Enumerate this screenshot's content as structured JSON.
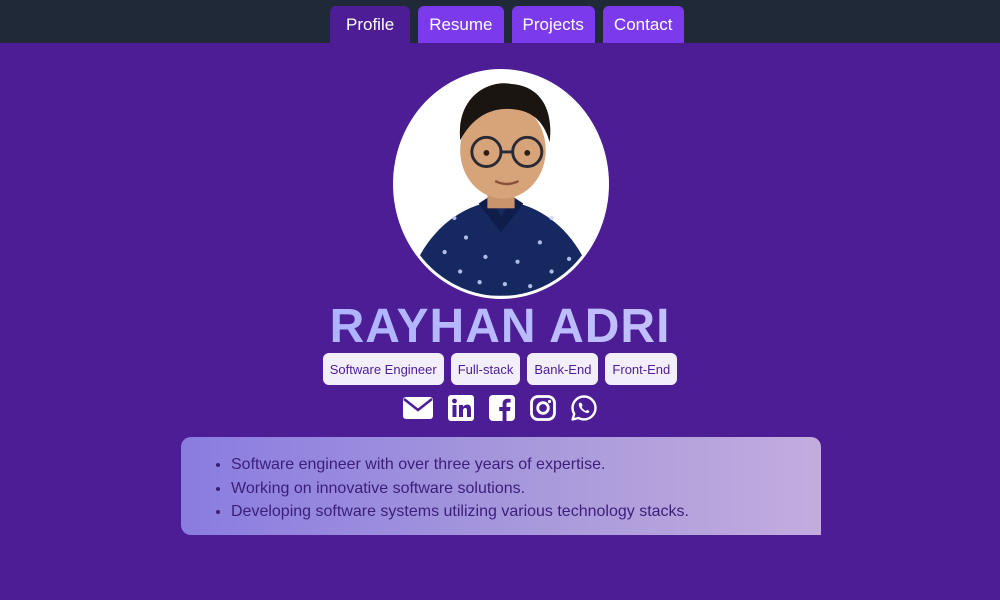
{
  "nav": {
    "tabs": [
      {
        "label": "Profile",
        "active": true
      },
      {
        "label": "Resume",
        "active": false
      },
      {
        "label": "Projects",
        "active": false
      },
      {
        "label": "Contact",
        "active": false
      }
    ]
  },
  "profile": {
    "name": "RAYHAN ADRI",
    "tags": [
      "Software Engineer",
      "Full-stack",
      "Bank-End",
      "Front-End"
    ],
    "socials": [
      "mail-icon",
      "linkedin-icon",
      "facebook-icon",
      "instagram-icon",
      "whatsapp-icon"
    ],
    "summary": [
      "Software engineer with over three years of expertise.",
      "Working on innovative software solutions.",
      "Developing software systems utilizing various technology stacks."
    ]
  },
  "colors": {
    "background": "#4c1d95",
    "topbar": "#1f2937",
    "tab_inactive": "#7c3aed",
    "tag_bg": "#f3eefc"
  }
}
